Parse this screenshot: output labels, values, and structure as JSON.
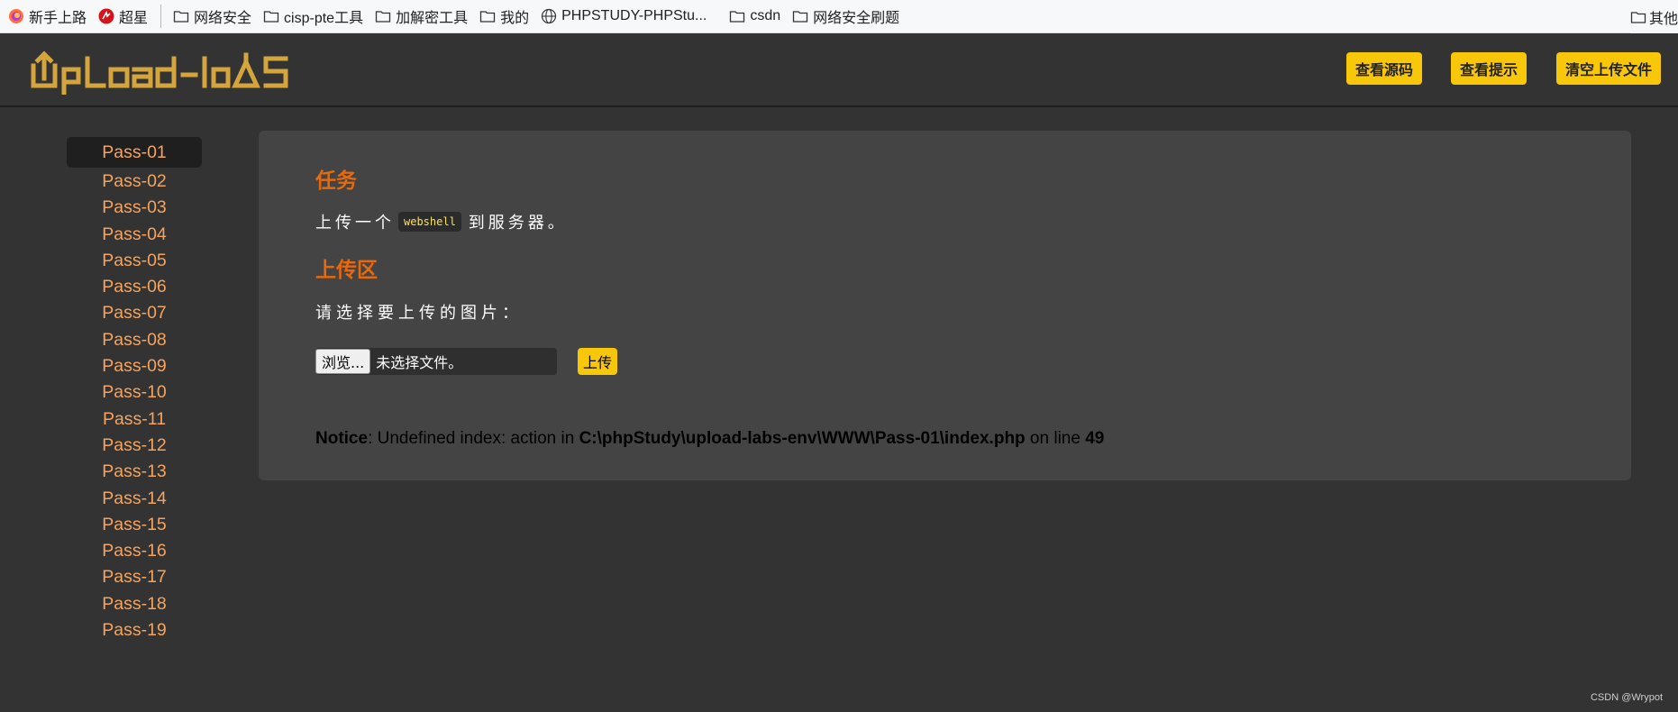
{
  "bookmarks": {
    "items": [
      {
        "label": "新手上路",
        "icon": "firefox-icon"
      },
      {
        "label": "超星",
        "icon": "chaoxing-icon"
      },
      {
        "label": "网络安全",
        "icon": "folder-icon"
      },
      {
        "label": "cisp-pte工具",
        "icon": "folder-icon"
      },
      {
        "label": "加解密工具",
        "icon": "folder-icon"
      },
      {
        "label": "我的",
        "icon": "folder-icon"
      },
      {
        "label": "PHPSTUDY-PHPStu...",
        "icon": "globe-icon"
      },
      {
        "label": "csdn",
        "icon": "folder-icon"
      },
      {
        "label": "网络安全刷题",
        "icon": "folder-icon"
      }
    ],
    "other": "其他"
  },
  "header": {
    "logo_text": "Upload-labs",
    "buttons": {
      "view_source": "查看源码",
      "view_hint": "查看提示",
      "clear_uploads": "清空上传文件"
    },
    "colors": {
      "accent": "#f9c70a",
      "logo": "#d4a53c"
    }
  },
  "sidebar": {
    "items": [
      "Pass-01",
      "Pass-02",
      "Pass-03",
      "Pass-04",
      "Pass-05",
      "Pass-06",
      "Pass-07",
      "Pass-08",
      "Pass-09",
      "Pass-10",
      "Pass-11",
      "Pass-12",
      "Pass-13",
      "Pass-14",
      "Pass-15",
      "Pass-16",
      "Pass-17",
      "Pass-18",
      "Pass-19"
    ],
    "active": "Pass-01",
    "link_color": "#f4a460"
  },
  "main": {
    "task_heading": "任务",
    "task_prefix": "上传一个",
    "task_code": "webshell",
    "task_suffix": "到服务器。",
    "upload_heading": "上传区",
    "prompt": "请选择要上传的图片：",
    "browse_label": "浏览...",
    "no_file": "未选择文件。",
    "upload_label": "上传",
    "notice": {
      "label": "Notice",
      "message": ": Undefined index: action in ",
      "path": "C:\\phpStudy\\upload-labs-env\\WWW\\Pass-01\\index.php",
      "line_text": " on line ",
      "line_number": "49"
    },
    "heading_color": "#e8680c"
  },
  "watermark": "CSDN @Wrypot"
}
